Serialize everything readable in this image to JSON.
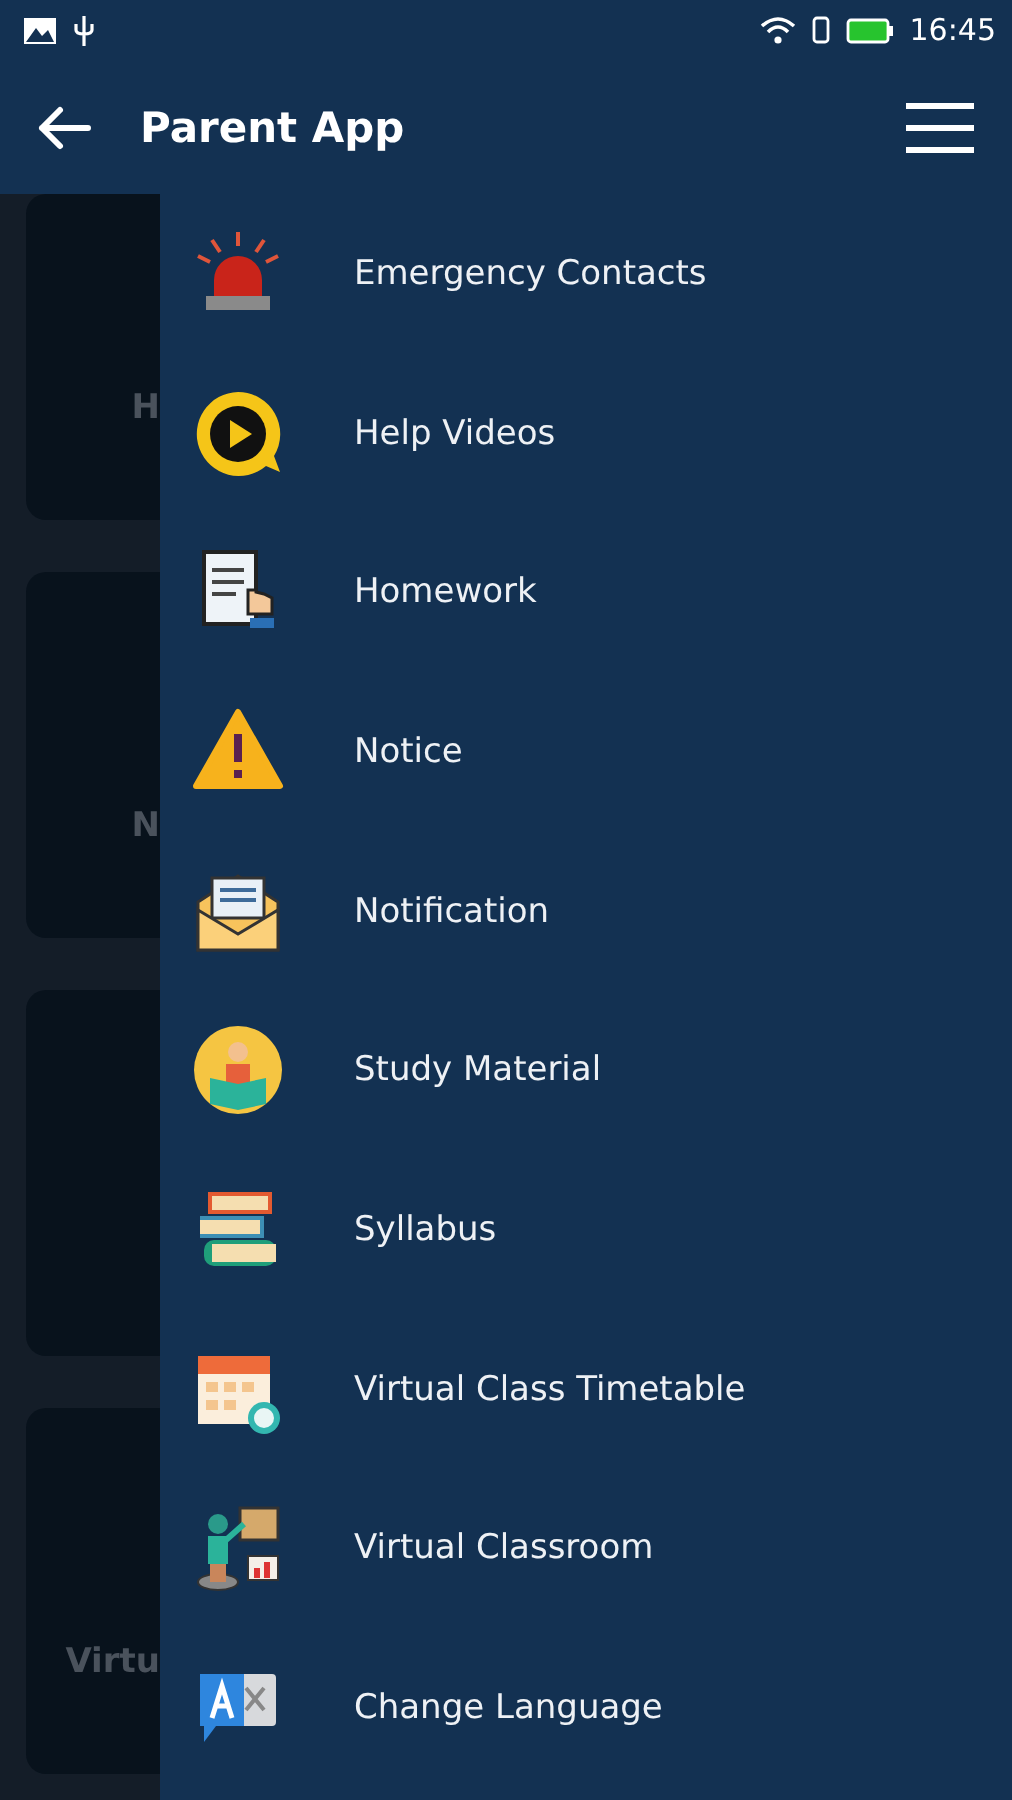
{
  "status_bar": {
    "time": "16:45"
  },
  "app_bar": {
    "title": "Parent App"
  },
  "background_cards": [
    {
      "kind": "labeled",
      "label": "H"
    },
    {
      "kind": "labeled",
      "label": "N"
    },
    {
      "kind": "blank"
    },
    {
      "kind": "labeled",
      "label": "Virtu"
    }
  ],
  "menu": [
    {
      "label": "Emergency Contacts",
      "kind": "siren"
    },
    {
      "label": "Help Videos",
      "kind": "video"
    },
    {
      "label": "Homework",
      "kind": "document"
    },
    {
      "label": "Notice",
      "kind": "warning"
    },
    {
      "label": "Notification",
      "kind": "envelope"
    },
    {
      "label": "Study Material",
      "kind": "reader"
    },
    {
      "label": "Syllabus",
      "kind": "books"
    },
    {
      "label": "Virtual Class Timetable",
      "kind": "calendar"
    },
    {
      "label": "Virtual Classroom",
      "kind": "teacher"
    },
    {
      "label": "Change Language",
      "kind": "translate"
    }
  ]
}
